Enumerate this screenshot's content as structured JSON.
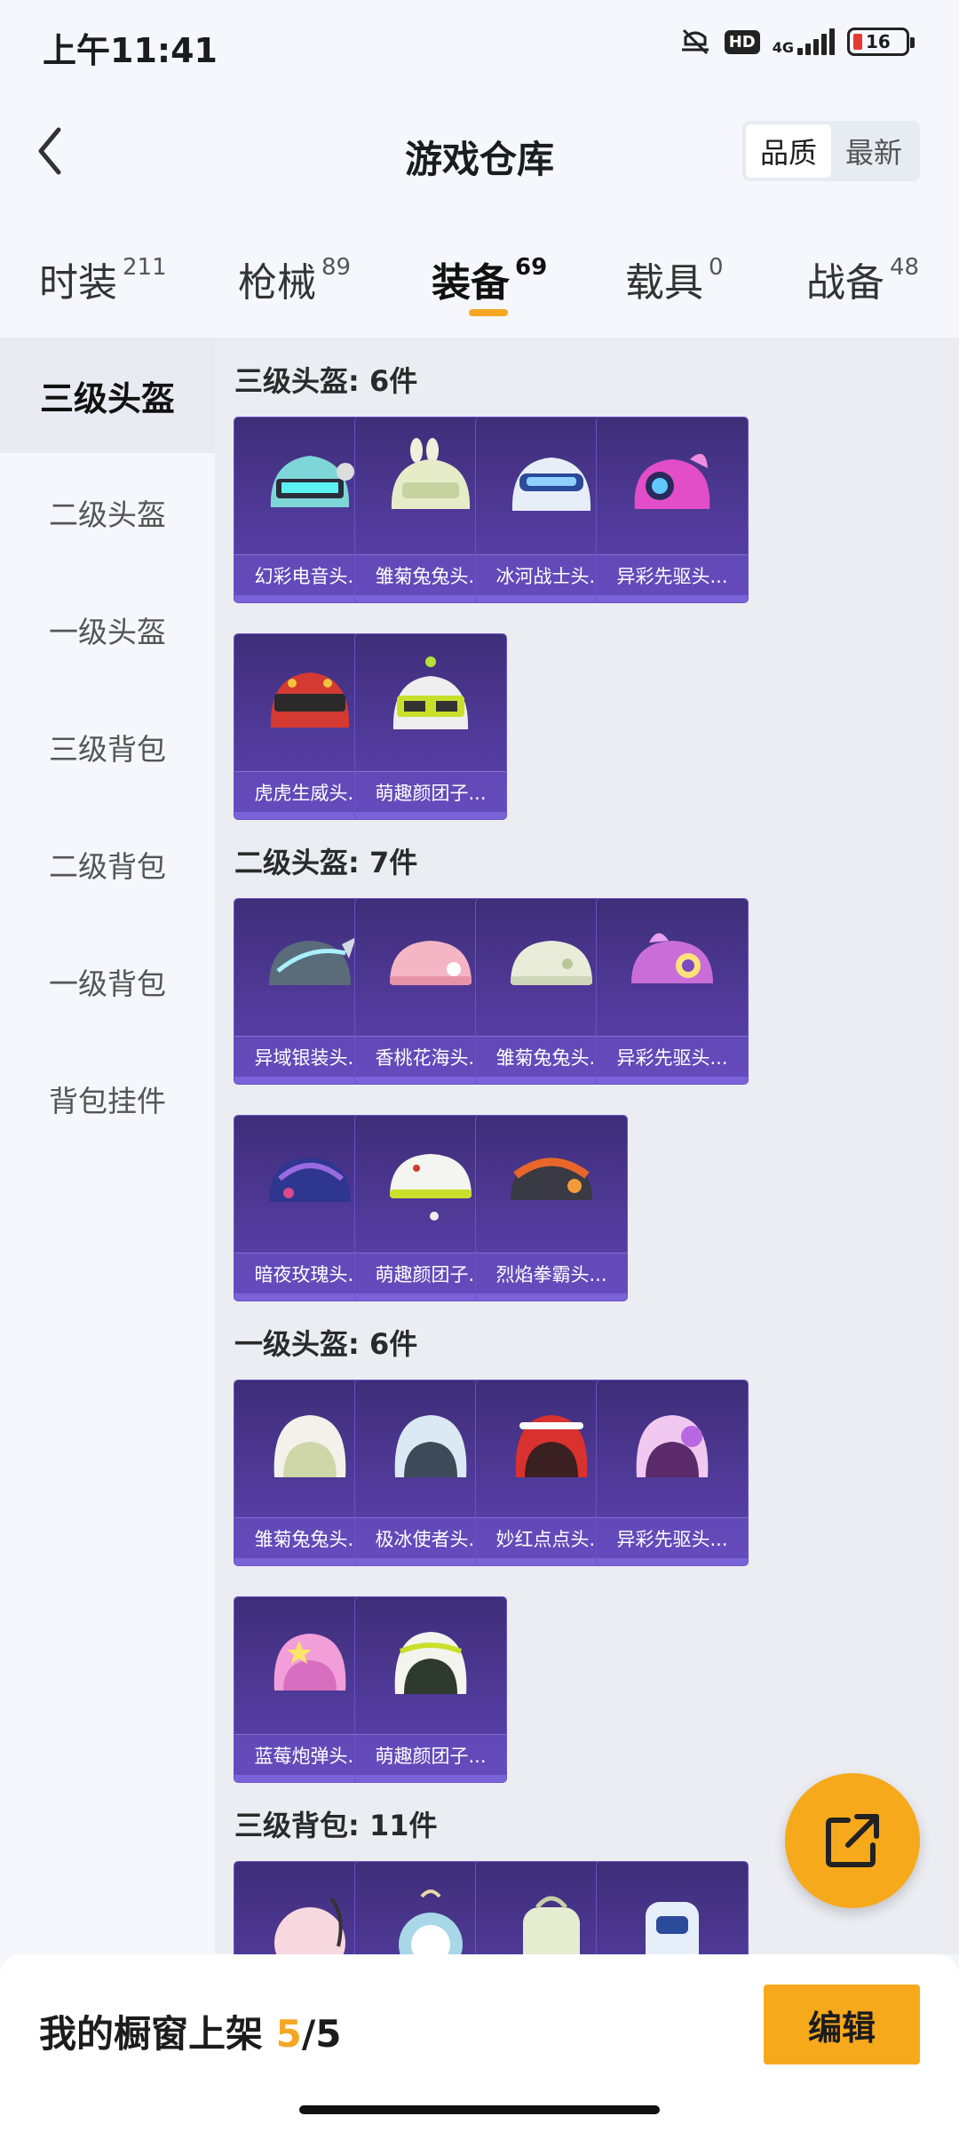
{
  "status": {
    "time": "上午11:41",
    "hd": "HD",
    "network": "4G",
    "battery": "16"
  },
  "header": {
    "title": "游戏仓库",
    "sort": [
      "品质",
      "最新"
    ]
  },
  "tabs": [
    {
      "label": "时装",
      "count": "211"
    },
    {
      "label": "枪械",
      "count": "89"
    },
    {
      "label": "装备",
      "count": "69"
    },
    {
      "label": "载具",
      "count": "0"
    },
    {
      "label": "战备",
      "count": "48"
    }
  ],
  "sidebar": [
    "三级头盔",
    "二级头盔",
    "一级头盔",
    "三级背包",
    "二级背包",
    "一级背包",
    "背包挂件"
  ],
  "sections": [
    {
      "title": "三级头盔: 6件",
      "items": [
        "幻彩电音头...",
        "雏菊兔兔头...",
        "冰河战士头...",
        "异彩先驱头...",
        "虎虎生威头...",
        "萌趣颜团子..."
      ]
    },
    {
      "title": "二级头盔: 7件",
      "items": [
        "异域银装头...",
        "香桃花海头...",
        "雏菊兔兔头...",
        "异彩先驱头...",
        "暗夜玫瑰头...",
        "萌趣颜团子...",
        "烈焰拳霸头..."
      ]
    },
    {
      "title": "一级头盔: 6件",
      "items": [
        "雏菊兔兔头...",
        "极冰使者头...",
        "妙红点点头...",
        "异彩先驱头...",
        "蓝莓炮弹头...",
        "萌趣颜团子..."
      ]
    },
    {
      "title": "三级背包: 11件",
      "items": [
        "",
        "",
        "",
        ""
      ]
    }
  ],
  "bottom": {
    "showcase_label": "我的橱窗上架",
    "showcase_current": "5",
    "showcase_total": "/5",
    "edit_label": "编辑"
  },
  "colors": {
    "accent": "#f7a91c",
    "card_bg": "#4a3690"
  }
}
